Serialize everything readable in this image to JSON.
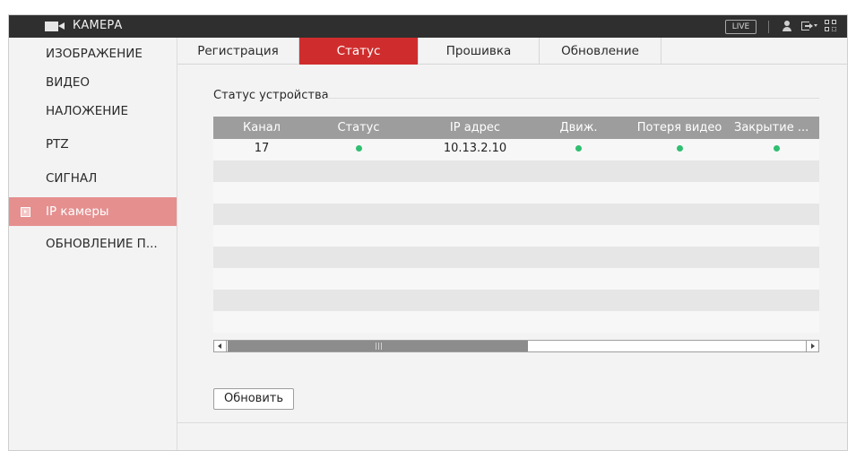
{
  "titlebar": {
    "title": "КАМЕРА",
    "live_label": "LIVE",
    "icons": [
      "camera-icon",
      "user-icon",
      "logout-icon",
      "qr-code-icon"
    ]
  },
  "sidebar": {
    "items": [
      {
        "label": "ИЗОБРАЖЕНИЕ",
        "active": false
      },
      {
        "label": "ВИДЕО",
        "active": false
      },
      {
        "label": "НАЛОЖЕНИЕ",
        "active": false
      },
      {
        "label": "PTZ",
        "active": false
      },
      {
        "label": "СИГНАЛ",
        "active": false
      },
      {
        "label": "IP камеры",
        "active": true
      },
      {
        "label": "ОБНОВЛЕНИЕ П...",
        "active": false
      }
    ]
  },
  "tabs": [
    {
      "label": "Регистрация",
      "active": false
    },
    {
      "label": "Статус",
      "active": true
    },
    {
      "label": "Прошивка",
      "active": false
    },
    {
      "label": "Обновление",
      "active": false
    }
  ],
  "status": {
    "section_label": "Статус устройства",
    "columns": [
      "Канал",
      "Статус",
      "IP адрес",
      "Движ.",
      "Потеря видео",
      "Закрытие ..."
    ],
    "rows": [
      {
        "channel": "17",
        "status": "online",
        "ip": "10.13.2.10",
        "motion": "ok",
        "video_loss": "ok",
        "tamper": "ok"
      }
    ],
    "status_color": "#2fbf71"
  },
  "buttons": {
    "refresh": "Обновить"
  },
  "colors": {
    "accent": "#cf2d2d",
    "sidebar_active": "#e58f8f",
    "titlebar": "#2f2f2f"
  }
}
